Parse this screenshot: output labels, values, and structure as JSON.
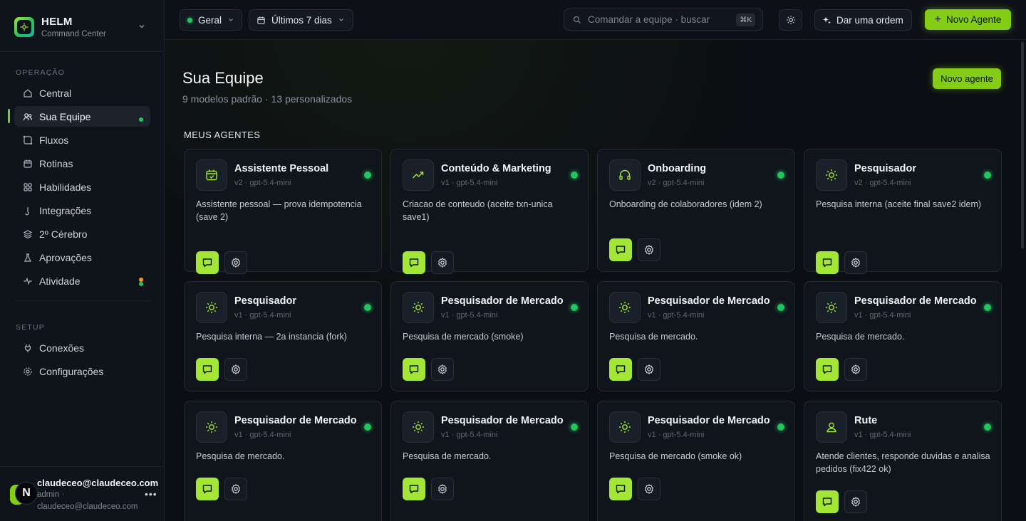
{
  "brand": {
    "title": "HELM",
    "subtitle": "Command Center"
  },
  "sidebar": {
    "section_operacao": "OPERAÇÃO",
    "section_setup": "SETUP",
    "items": [
      {
        "label": "Central",
        "icon": "home-icon"
      },
      {
        "label": "Sua Equipe",
        "icon": "users-icon"
      },
      {
        "label": "Fluxos",
        "icon": "workflow-icon"
      },
      {
        "label": "Rotinas",
        "icon": "calendar-icon"
      },
      {
        "label": "Habilidades",
        "icon": "grid-icon"
      },
      {
        "label": "Integrações",
        "icon": "plug-icon"
      },
      {
        "label": "2º Cérebro",
        "icon": "layers-icon"
      },
      {
        "label": "Aprovações",
        "icon": "flask-icon"
      },
      {
        "label": "Atividade",
        "icon": "activity-icon"
      }
    ],
    "setup_items": [
      {
        "label": "Conexões",
        "icon": "plug-icon"
      },
      {
        "label": "Configurações",
        "icon": "gear-icon"
      }
    ]
  },
  "user": {
    "initial": "N",
    "name": "claudeceo@claudeceo.com",
    "role": "admin ·",
    "email": "claudeceo@claudeceo.com"
  },
  "topbar": {
    "scope": "Geral",
    "period": "Últimos 7 dias",
    "search_placeholder": "Comandar a equipe · buscar",
    "shortcut": "⌘K",
    "order_label": "Dar uma ordem",
    "new_agent_label": "Novo Agente"
  },
  "page": {
    "title": "Sua Equipe",
    "subtitle": "9 modelos padrão · 13 personalizados",
    "new_button": "Novo agente",
    "section": "MEUS AGENTES"
  },
  "agents": [
    {
      "name": "Assistente Pessoal",
      "meta": "v2 · gpt-5.4-mini",
      "desc": "Assistente pessoal — prova idempotencia (save 2)",
      "icon": "calendar-check-icon"
    },
    {
      "name": "Conteúdo & Marketing",
      "meta": "v1 · gpt-5.4-mini",
      "desc": "Criacao de conteudo (aceite txn-unica save1)",
      "icon": "trending-up-icon"
    },
    {
      "name": "Onboarding",
      "meta": "v2 · gpt-5.4-mini",
      "desc": "Onboarding de colaboradores (idem 2)",
      "icon": "headphones-icon"
    },
    {
      "name": "Pesquisador",
      "meta": "v2 · gpt-5.4-mini",
      "desc": "Pesquisa interna (aceite final save2 idem)",
      "icon": "sun-icon"
    },
    {
      "name": "Pesquisador",
      "meta": "v1 · gpt-5.4-mini",
      "desc": "Pesquisa interna — 2a instancia (fork)",
      "icon": "sun-icon"
    },
    {
      "name": "Pesquisador de Mercado",
      "meta": "v1 · gpt-5.4-mini",
      "desc": "Pesquisa de mercado (smoke)",
      "icon": "sun-icon"
    },
    {
      "name": "Pesquisador de Mercado",
      "meta": "v1 · gpt-5.4-mini",
      "desc": "Pesquisa de mercado.",
      "icon": "sun-icon"
    },
    {
      "name": "Pesquisador de Mercado",
      "meta": "v1 · gpt-5.4-mini",
      "desc": "Pesquisa de mercado.",
      "icon": "sun-icon"
    },
    {
      "name": "Pesquisador de Mercado",
      "meta": "v1 · gpt-5.4-mini",
      "desc": "Pesquisa de mercado.",
      "icon": "sun-icon"
    },
    {
      "name": "Pesquisador de Mercado",
      "meta": "v1 · gpt-5.4-mini",
      "desc": "Pesquisa de mercado.",
      "icon": "sun-icon"
    },
    {
      "name": "Pesquisador de Mercado",
      "meta": "v1 · gpt-5.4-mini",
      "desc": "Pesquisa de mercado (smoke ok)",
      "icon": "sun-icon"
    },
    {
      "name": "Rute",
      "meta": "v1 · gpt-5.4-mini",
      "desc": "Atende clientes, responde duvidas e analisa pedidos (fix422 ok)",
      "icon": "user-icon"
    }
  ],
  "colors": {
    "accent": "#84cc16",
    "accent_bright": "#a3e635",
    "status": "#22c55e",
    "background": "#0b0e13"
  }
}
